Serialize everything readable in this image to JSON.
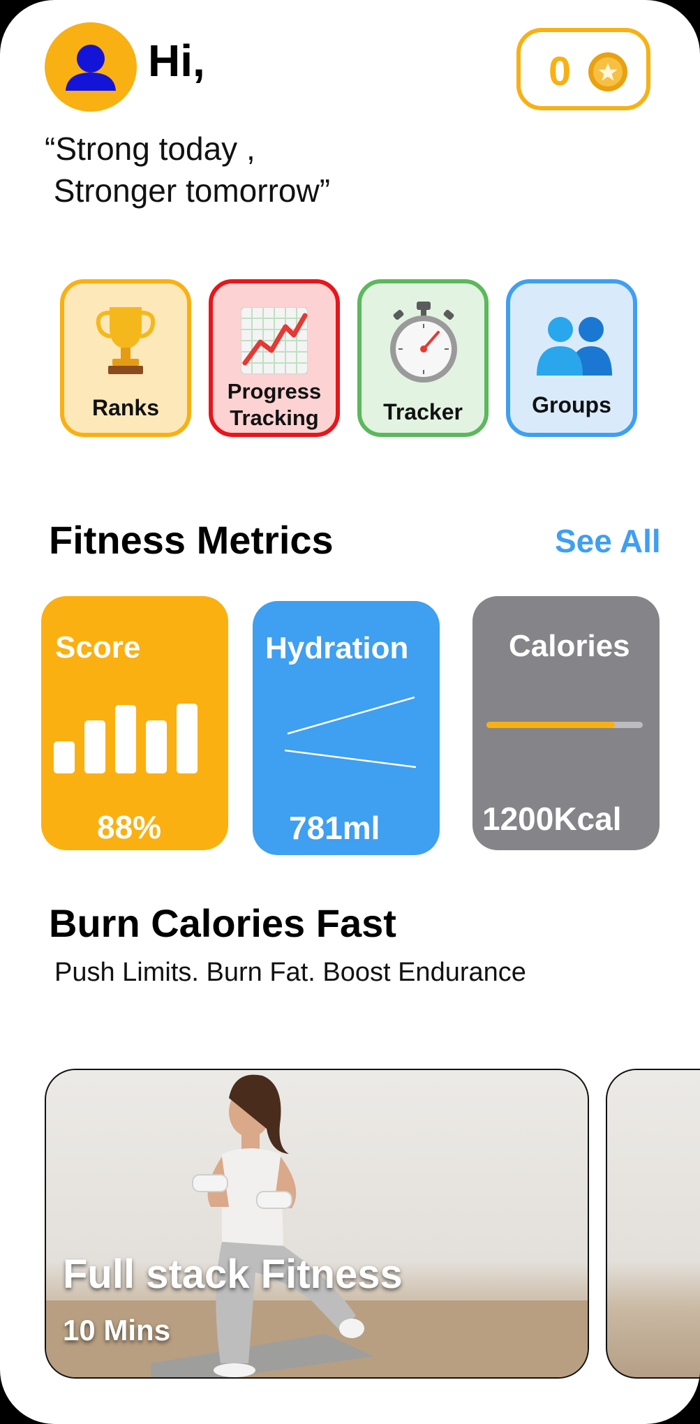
{
  "header": {
    "greeting": "Hi,",
    "coin_count": "0",
    "quote_line1": "“Strong today ,",
    "quote_line2": " Stronger tomorrow”"
  },
  "quick_actions": [
    {
      "label": "Ranks",
      "icon": "trophy-icon"
    },
    {
      "label_line1": "Progress",
      "label_line2": "Tracking",
      "icon": "chart-increasing-icon"
    },
    {
      "label": "Tracker",
      "icon": "stopwatch-icon"
    },
    {
      "label": "Groups",
      "icon": "people-icon"
    }
  ],
  "metrics": {
    "title": "Fitness Metrics",
    "see_all": "See All",
    "score": {
      "title": "Score",
      "value": "88%"
    },
    "hydration": {
      "title": "Hydration",
      "value": "781ml"
    },
    "calories": {
      "title": "Calories",
      "value": "1200Kcal",
      "progress": 0.82
    }
  },
  "burn": {
    "title": "Burn Calories Fast",
    "subtitle": "Push Limits. Burn Fat. Boost Endurance"
  },
  "workouts": [
    {
      "title": "Full stack Fitness",
      "duration": "10 Mins"
    }
  ],
  "colors": {
    "accent_yellow": "#f9b012",
    "accent_blue": "#3f9ff0",
    "accent_red": "#e8151b",
    "accent_green": "#5cb85c",
    "card_gray": "#858488"
  }
}
